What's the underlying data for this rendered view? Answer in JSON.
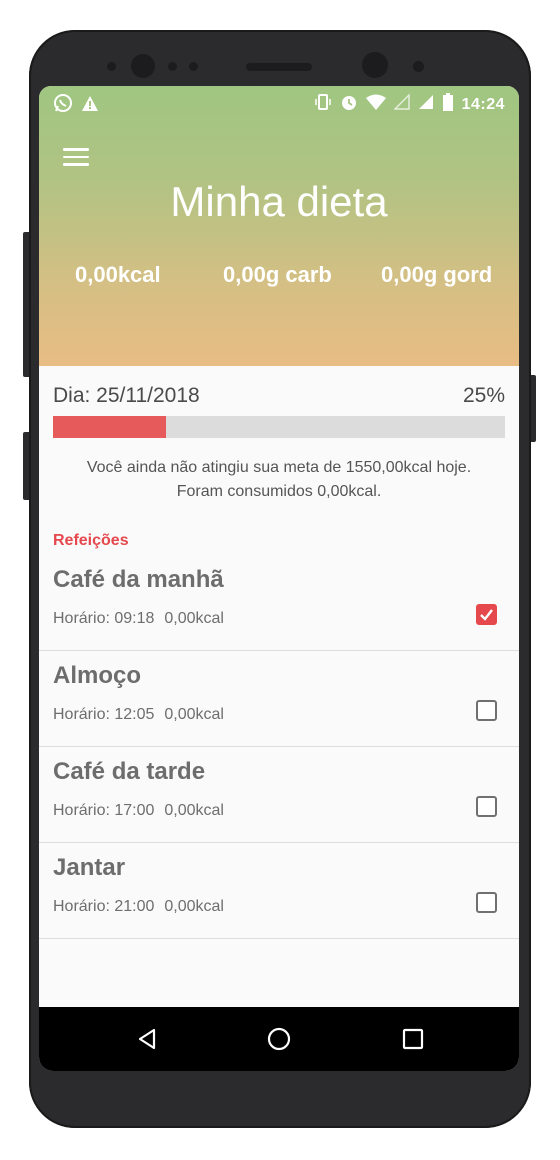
{
  "status_bar": {
    "left_icons": [
      "whatsapp-icon",
      "warning-icon"
    ],
    "right_icons": [
      "vibrate-icon",
      "alarm-icon",
      "wifi-icon",
      "signal-empty-icon",
      "signal-icon",
      "battery-icon"
    ],
    "time": "14:24"
  },
  "header": {
    "title": "Minha dieta",
    "kcal": "0,00kcal",
    "carb": "0,00g carb",
    "fat": "0,00g gord"
  },
  "progress": {
    "day_label": "Dia: 25/11/2018",
    "percent_label": "25%",
    "fraction": 0.25,
    "message_line1": "Você ainda não atingiu sua meta de 1550,00kcal hoje.",
    "message_line2": "Foram consumidos 0,00kcal."
  },
  "meals_section": {
    "title": "Refeições",
    "items": [
      {
        "name": "Café da manhã",
        "time": "Horário: 09:18",
        "kcal": "0,00kcal",
        "checked": true
      },
      {
        "name": "Almoço",
        "time": "Horário: 12:05",
        "kcal": "0,00kcal",
        "checked": false
      },
      {
        "name": "Café da tarde",
        "time": "Horário: 17:00",
        "kcal": "0,00kcal",
        "checked": false
      },
      {
        "name": "Jantar",
        "time": "Horário: 21:00",
        "kcal": "0,00kcal",
        "checked": false
      }
    ]
  },
  "nav_bar": {
    "icons": [
      "back-icon",
      "home-icon",
      "recents-icon"
    ]
  },
  "colors": {
    "accent": "#e5484d",
    "progress_fill": "#e75a5c",
    "header_top": "#9fc682",
    "header_bottom": "#e8bd84"
  }
}
